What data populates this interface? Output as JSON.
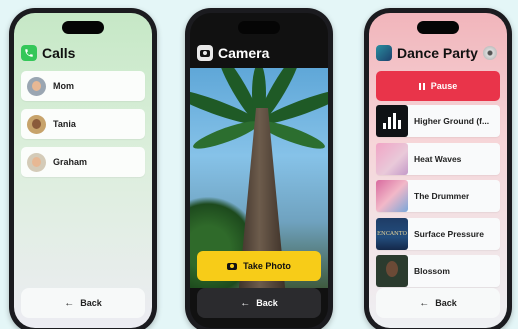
{
  "phones": [
    {
      "app": "calls",
      "title": "Calls",
      "icon": "phone-icon",
      "contacts": [
        "Mom",
        "Tania",
        "Graham"
      ],
      "back_label": "Back"
    },
    {
      "app": "camera",
      "title": "Camera",
      "icon": "camera-icon",
      "take_photo_label": "Take Photo",
      "back_label": "Back"
    },
    {
      "app": "music",
      "title": "Dance Party",
      "icon": "playlist-icon",
      "pause_label": "Pause",
      "songs": [
        "Higher Ground (f...",
        "Heat Waves",
        "The Drummer",
        "Surface Pressure",
        "Blossom"
      ],
      "surface_art_text": "ENCANTO",
      "back_label": "Back"
    }
  ],
  "colors": {
    "background": "#e4f6f7",
    "calls_accent": "#34c759",
    "take_photo": "#f7cc18",
    "pause": "#e9344a"
  }
}
